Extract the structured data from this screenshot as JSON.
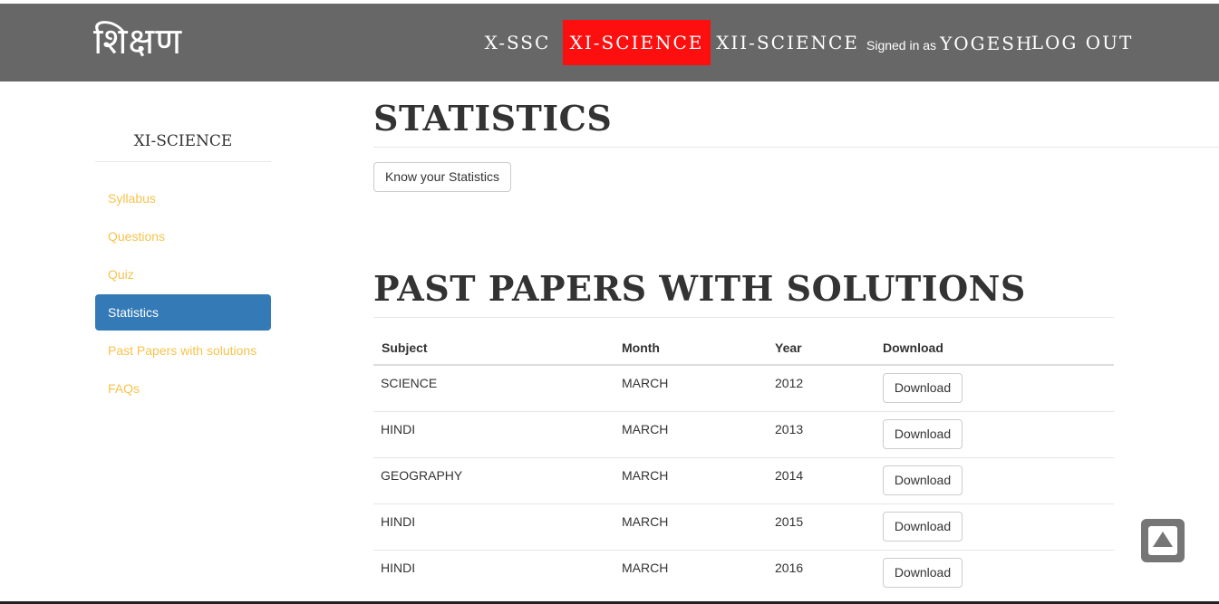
{
  "navbar": {
    "brand": "शिक्षण",
    "items": [
      {
        "label": "X-SSC",
        "active": false
      },
      {
        "label": "XI-SCIENCE",
        "active": true
      },
      {
        "label": "XII-SCIENCE",
        "active": false
      }
    ],
    "signed_in_text": "Signed in as",
    "username": "YOGESH",
    "logout_label": "LOG OUT",
    "background_color": "#676767",
    "active_color": "#fe0f0f"
  },
  "sidebar": {
    "title": "XI-SCIENCE",
    "items": [
      {
        "label": "Syllabus",
        "active": false
      },
      {
        "label": "Questions",
        "active": false
      },
      {
        "label": "Quiz",
        "active": false
      },
      {
        "label": "Statistics",
        "active": true
      },
      {
        "label": "Past Papers with solutions",
        "active": false
      },
      {
        "label": "FAQs",
        "active": false
      }
    ],
    "link_color": "#f7c34d",
    "active_color": "#337ab7"
  },
  "main": {
    "statistics_heading": "STATISTICS",
    "statistics_button": "Know your Statistics",
    "papers_heading": "PAST PAPERS WITH SOLUTIONS",
    "table": {
      "headers": {
        "subject": "Subject",
        "month": "Month",
        "year": "Year",
        "download": "Download"
      },
      "rows": [
        {
          "subject": "SCIENCE",
          "month": "MARCH",
          "year": "2012",
          "action": "Download"
        },
        {
          "subject": "HINDI",
          "month": "MARCH",
          "year": "2013",
          "action": "Download"
        },
        {
          "subject": "GEOGRAPHY",
          "month": "MARCH",
          "year": "2014",
          "action": "Download"
        },
        {
          "subject": "HINDI",
          "month": "MARCH",
          "year": "2015",
          "action": "Download"
        },
        {
          "subject": "HINDI",
          "month": "MARCH",
          "year": "2016",
          "action": "Download"
        }
      ]
    }
  },
  "scroll_top_icon": "arrow-up-icon"
}
